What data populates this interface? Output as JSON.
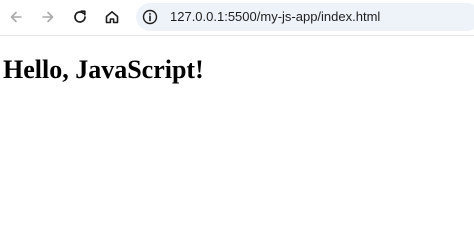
{
  "browser": {
    "url": "127.0.0.1:5500/my-js-app/index.html",
    "nav_icons": [
      "arrow-left-icon",
      "arrow-right-icon",
      "reload-icon",
      "home-icon"
    ],
    "site_info_icon": "info-circle-icon"
  },
  "page": {
    "heading": "Hello, JavaScript!"
  },
  "colors": {
    "omnibox_bg": "#eef2f9",
    "icon_active": "#1f1f1f",
    "icon_disabled": "#a8a8a8",
    "text": "#000000"
  }
}
